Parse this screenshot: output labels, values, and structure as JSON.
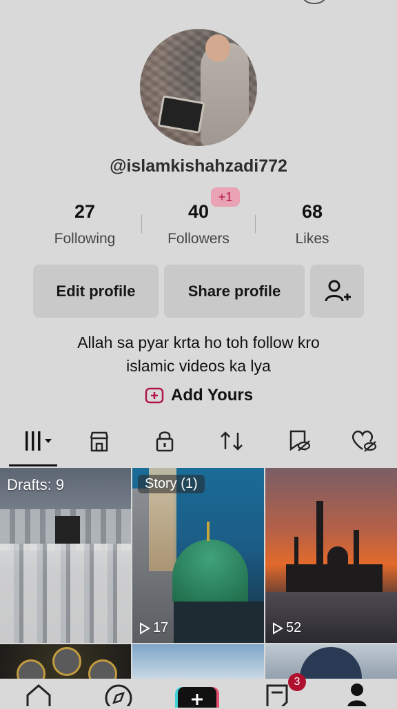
{
  "profile": {
    "username": "@islamkishahzadi772",
    "stats": [
      {
        "value": "27",
        "label": "Following"
      },
      {
        "value": "40",
        "label": "Followers",
        "badge": "+1"
      },
      {
        "value": "68",
        "label": "Likes"
      }
    ],
    "buttons": {
      "edit_profile": "Edit profile",
      "share_profile": "Share profile"
    },
    "bio_line1": "Allah sa pyar krta ho toh follow kro",
    "bio_line2": "islamic videos ka lya",
    "add_yours": "Add Yours"
  },
  "tabs": [
    {
      "name": "videos-grid"
    },
    {
      "name": "shop"
    },
    {
      "name": "private"
    },
    {
      "name": "reposts"
    },
    {
      "name": "favorites-hidden"
    },
    {
      "name": "liked-hidden"
    }
  ],
  "grid": {
    "drafts_label": "Drafts: 9",
    "story_label": "Story (1)",
    "story_plays": "17",
    "video_plays": "52"
  },
  "nav": {
    "inbox_badge": "3"
  },
  "colors": {
    "background": "#d9d9d9",
    "badge_bg": "#e9a3b4",
    "badge_text": "#b1164a",
    "notification_red": "#b0102f",
    "button_bg": "#c9c9c9"
  }
}
